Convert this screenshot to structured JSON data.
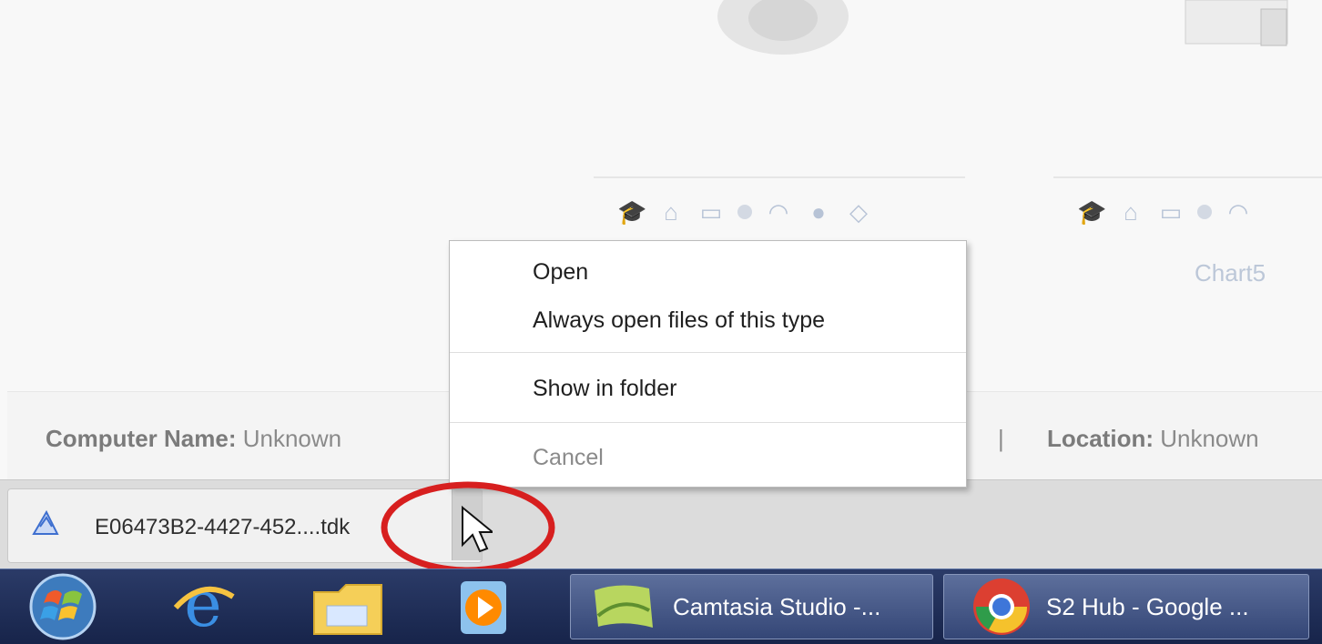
{
  "dashboard": {
    "chart_label": "Chart5",
    "computer_name_label": "Computer Name:",
    "computer_name_value": "Unknown",
    "separator": "|",
    "location_label": "Location:",
    "location_value": "Unknown"
  },
  "context_menu": {
    "items": [
      "Open",
      "Always open files of this type",
      "Show in folder",
      "Cancel"
    ]
  },
  "download_bar": {
    "file_name": "E06473B2-4427-452....tdk"
  },
  "taskbar": {
    "buttons": [
      "Camtasia Studio -...",
      "S2 Hub - Google ..."
    ]
  },
  "colors": {
    "taskbar": "#1e2b54",
    "menu_border": "#bcbcbc",
    "highlight_circle": "#d71f1f"
  },
  "icons": [
    "graduation-cap-icon",
    "home-icon",
    "monitor-icon",
    "wifi-icon",
    "circle-icon",
    "chat-icon",
    "start-orb-icon",
    "internet-explorer-icon",
    "folder-icon",
    "media-player-icon",
    "chrome-icon",
    "mouse-cursor-icon"
  ]
}
